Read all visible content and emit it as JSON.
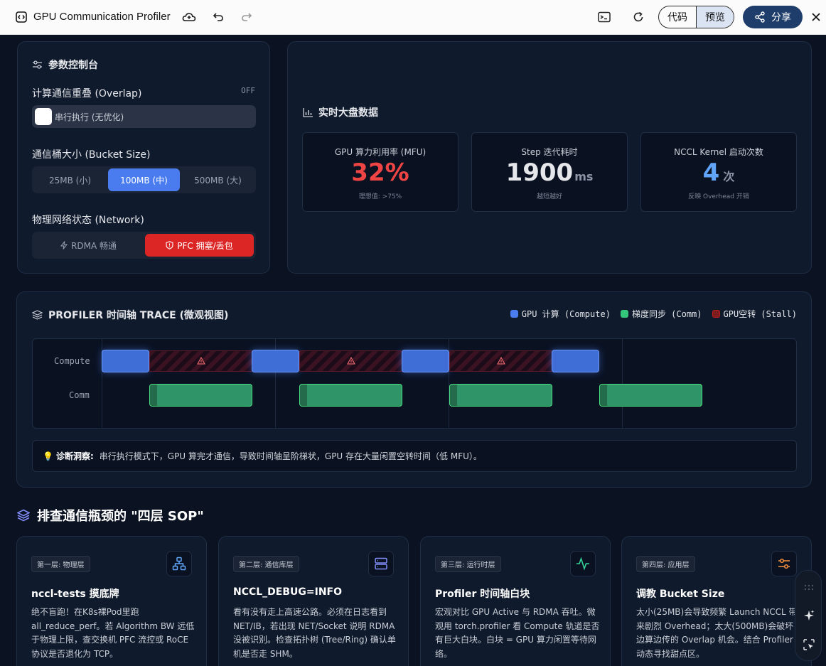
{
  "topbar": {
    "title": "GPU Communication Profiler",
    "code_label": "代码",
    "preview_label": "预览",
    "share_label": "分享"
  },
  "controls": {
    "title": "参数控制台",
    "overlap": {
      "label": "计算通信重叠 (Overlap)",
      "state": "OFF",
      "toggle_text": "串行执行 (无优化)"
    },
    "bucket": {
      "label": "通信桶大小 (Bucket Size)",
      "options": [
        "25MB (小)",
        "100MB (中)",
        "500MB (大)"
      ],
      "selected": "100MB (中)"
    },
    "network": {
      "label": "物理网络状态 (Network)",
      "options": [
        "RDMA 畅通",
        "PFC 拥塞/丢包"
      ],
      "selected": "PFC 拥塞/丢包"
    }
  },
  "dashboard": {
    "title": "实时大盘数据",
    "stats": [
      {
        "caption": "GPU 算力利用率 (MFU)",
        "value": "32%",
        "unit": "",
        "sub": "理想值: >75%",
        "color": "#ef4444"
      },
      {
        "caption": "Step 迭代耗时",
        "value": "1900",
        "unit": "ms",
        "sub": "越短越好",
        "color": "#e5e7eb"
      },
      {
        "caption": "NCCL Kernel 启动次数",
        "value": "4",
        "unit": "次",
        "sub": "反映 Overhead 开销",
        "color": "#60a5fa"
      }
    ]
  },
  "trace": {
    "title": "PROFILER 时间轴 TRACE (微观视图)",
    "legend": [
      {
        "label": "GPU 计算 (Compute)",
        "color": "#4a7cf0"
      },
      {
        "label": "梯度同步 (Comm)",
        "color": "#34c77b"
      },
      {
        "label": "GPU空转 (Stall)",
        "color": "#7f1d1d"
      }
    ],
    "rows": [
      "Compute",
      "Comm"
    ],
    "diagnosis_label": "诊断洞察:",
    "diagnosis_text": "串行执行模式下，GPU 算完才通信，导致时间轴呈阶梯状，GPU 存在大量闲置空转时间（低 MFU）。"
  },
  "sop": {
    "title": "排查通信瓶颈的 \"四层 SOP\"",
    "cards": [
      {
        "tag": "第一层: 物理层",
        "title": "nccl-tests 摸底牌",
        "desc": "绝不盲跑！在K8s裸Pod里跑 all_reduce_perf。若 Algorithm BW 远低于物理上限，查交换机 PFC 流控或 RoCE 协议是否退化为 TCP。",
        "icon": "network-tree-icon",
        "color": "#60a5fa"
      },
      {
        "tag": "第二层: 通信库层",
        "title": "NCCL_DEBUG=INFO",
        "desc": "看有没有走上高速公路。必须在日志看到 NET/IB，若出现 NET/Socket 说明 RDMA 没被识别。检查拓扑树 (Tree/Ring) 确认单机是否走 SHM。",
        "icon": "server-stack-icon",
        "color": "#818cf8"
      },
      {
        "tag": "第三层: 运行时层",
        "title": "Profiler 时间轴白块",
        "desc": "宏观对比 GPU Active 与 RDMA 吞吐。微观用 torch.profiler 看 Compute 轨道是否有巨大白块。白块 = GPU 算力闲置等待网络。",
        "icon": "activity-pulse-icon",
        "color": "#34d399"
      },
      {
        "tag": "第四层: 应用层",
        "title": "调教 Bucket Size",
        "desc": "太小(25MB)会导致频繁 Launch NCCL 带来剧烈 Overhead；太大(500MB)会破坏边算边传的 Overlap 机会。结合 Profiler 动态寻找甜点区。",
        "icon": "sliders-icon",
        "color": "#fb923c"
      }
    ]
  }
}
